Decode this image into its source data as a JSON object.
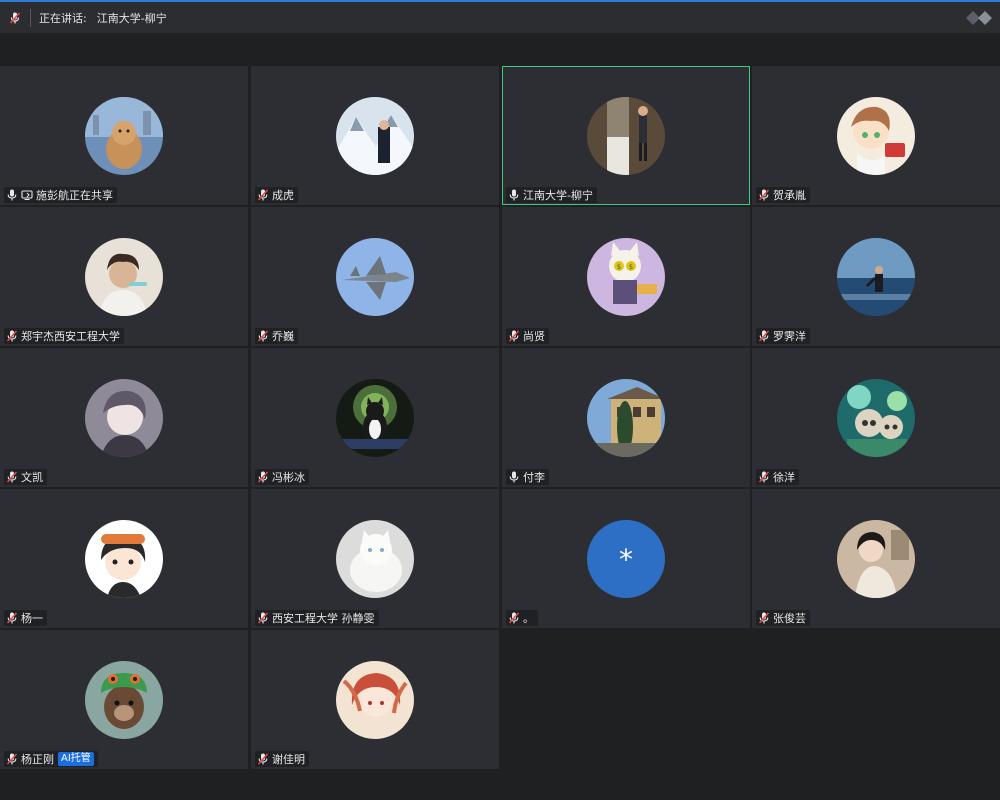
{
  "header": {
    "speaking_label": "正在讲话:",
    "speaking_name": "江南大学-柳宁"
  },
  "colors": {
    "accent": "#2f7ad9",
    "active_border": "#3ec983",
    "tile_bg": "#2c2e33",
    "badge_bg": "#1a6fe0",
    "muted_mic": "#e24a4a"
  },
  "participants": [
    {
      "name": "施彭航正在共享",
      "mic": "on",
      "sharing": true,
      "avatar": "dog-photo"
    },
    {
      "name": "成虎",
      "mic": "muted",
      "avatar": "snow-mountain-photo"
    },
    {
      "name": "江南大学-柳宁",
      "mic": "on",
      "active": true,
      "avatar": "tree-photo"
    },
    {
      "name": "贺承胤",
      "mic": "muted",
      "avatar": "anime-boy"
    },
    {
      "name": "郑宇杰西安工程大学",
      "mic": "muted",
      "avatar": "man-portrait"
    },
    {
      "name": "乔巍",
      "mic": "muted",
      "avatar": "fighter-jet"
    },
    {
      "name": "尚贤",
      "mic": "muted",
      "avatar": "cartoon-cat"
    },
    {
      "name": "罗霁洋",
      "mic": "muted",
      "avatar": "sea-photo"
    },
    {
      "name": "文凯",
      "mic": "muted",
      "avatar": "anime-grey-hair"
    },
    {
      "name": "冯彬冰",
      "mic": "muted",
      "avatar": "black-cat"
    },
    {
      "name": "付李",
      "mic": "on",
      "avatar": "building-photo"
    },
    {
      "name": "徐洋",
      "mic": "muted",
      "avatar": "anime-green"
    },
    {
      "name": "杨一",
      "mic": "muted",
      "avatar": "anime-goggles"
    },
    {
      "name": "西安工程大学 孙静雯",
      "mic": "muted",
      "avatar": "white-cat"
    },
    {
      "name": "。",
      "mic": "muted",
      "avatar": "asterisk",
      "avatar_text": "*",
      "avatar_color": "#2d6fc4"
    },
    {
      "name": "张俊芸",
      "mic": "muted",
      "avatar": "woman-photo"
    },
    {
      "name": "杨正刚",
      "mic": "muted",
      "avatar": "otter-photo",
      "badge": "AI托管"
    },
    {
      "name": "谢佳明",
      "mic": "muted",
      "avatar": "anime-red-hair"
    }
  ]
}
